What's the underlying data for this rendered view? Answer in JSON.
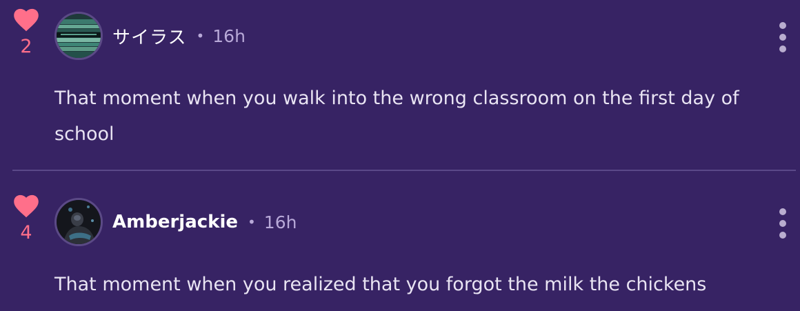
{
  "comments": [
    {
      "likes": "2",
      "username": "サイラス",
      "separator": "•",
      "time": "16h",
      "text": "That moment when you walk into the wrong classroom on the first day of school"
    },
    {
      "likes": "4",
      "username": "Amberjackie",
      "separator": "•",
      "time": "16h",
      "text": "That moment when you realized that you forgot the milk the chickens"
    }
  ],
  "colors": {
    "background": "#372364",
    "heart": "#ff6f8a",
    "username": "#ffffff",
    "muted": "#b8a9d8",
    "divider": "#5a4888"
  },
  "icons": {
    "like": "heart-icon",
    "more": "more-vertical-icon"
  }
}
